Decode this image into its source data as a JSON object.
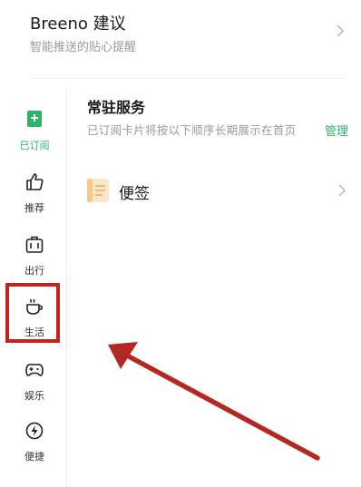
{
  "breeno": {
    "title": "Breeno 建议",
    "subtitle": "智能推送的贴心提醒"
  },
  "sidebar": {
    "items": [
      {
        "label": "已订阅",
        "icon": "subscribed-icon",
        "active": true
      },
      {
        "label": "推荐",
        "icon": "thumbs-up-icon",
        "active": false
      },
      {
        "label": "出行",
        "icon": "luggage-icon",
        "active": false
      },
      {
        "label": "生活",
        "icon": "cup-icon",
        "active": false
      },
      {
        "label": "娱乐",
        "icon": "gamepad-icon",
        "active": false
      },
      {
        "label": "便捷",
        "icon": "lightning-icon",
        "active": false
      }
    ]
  },
  "main": {
    "section_title": "常驻服务",
    "section_desc": "已订阅卡片将按以下顺序长期展示在首页",
    "manage_label": "管理",
    "services": [
      {
        "label": "便签",
        "icon": "note-icon"
      }
    ]
  },
  "colors": {
    "accent": "#2fb26a",
    "highlight": "#c0241e",
    "annotation_arrow": "#b32820"
  }
}
